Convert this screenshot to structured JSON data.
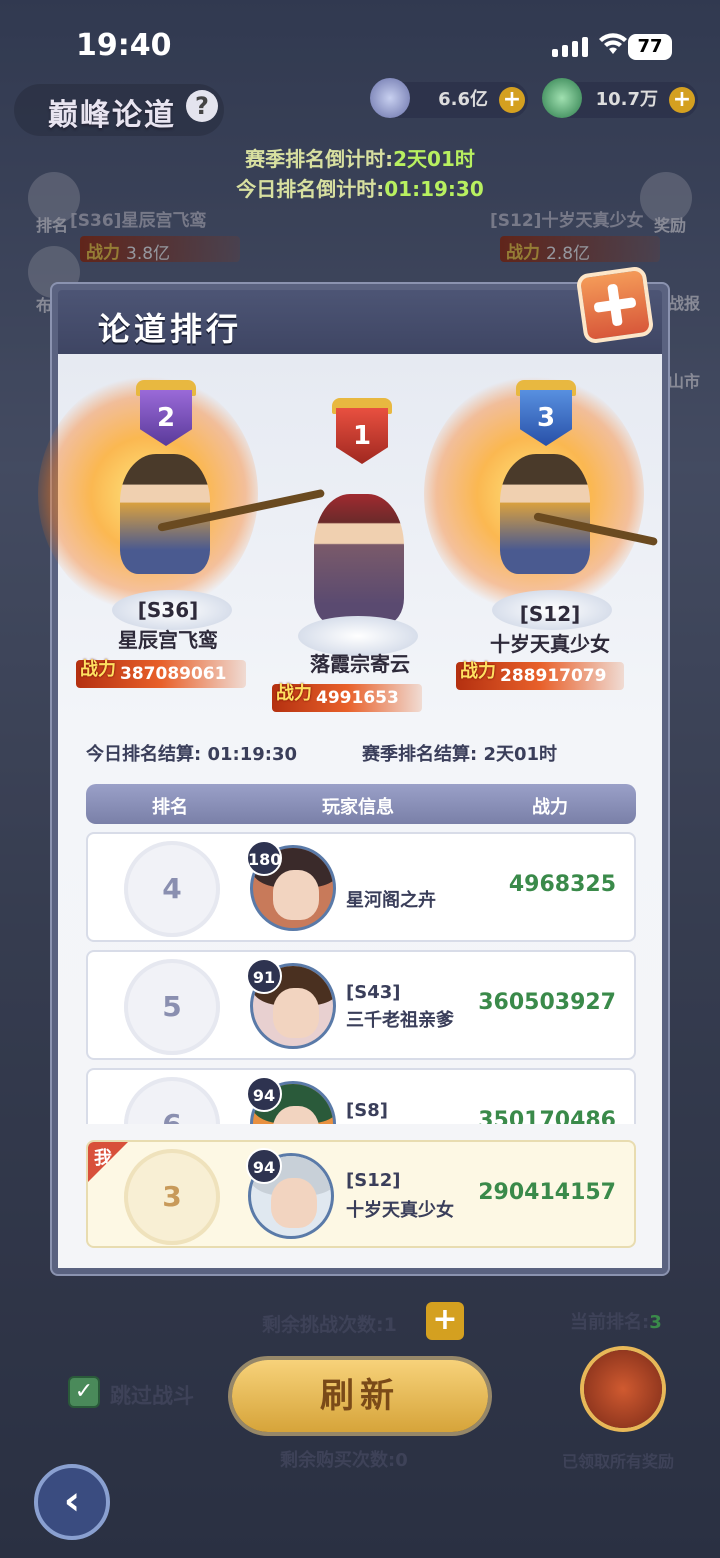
{
  "status": {
    "time": "19:40",
    "battery": "77"
  },
  "header": {
    "title": "巅峰论道",
    "help": "?",
    "currency1": "6.6亿",
    "currency2": "10.7万",
    "season_countdown_label": "赛季排名倒计时:",
    "season_countdown_value": "2天01时",
    "today_countdown_label": "今日排名倒计时:",
    "today_countdown_value": "01:19:30"
  },
  "side": {
    "rank": "排名",
    "layout": "布",
    "reward": "奖励",
    "report": "战报",
    "market": "山市"
  },
  "bg_cards": {
    "left_name": "[S36]星辰宫飞鸾",
    "left_power": "3.8亿",
    "right_name": "[S12]十岁天真少女",
    "right_power": "2.8亿",
    "power_label": "战力"
  },
  "panel": {
    "title": "论道排行",
    "power_label": "战力",
    "podium": [
      {
        "rank": "2",
        "server": "[S36]",
        "name": "星辰宫飞鸾",
        "power": "387089061"
      },
      {
        "rank": "1",
        "server": "",
        "name": "落霞宗寄云",
        "power": "4991653"
      },
      {
        "rank": "3",
        "server": "[S12]",
        "name": "十岁天真少女",
        "power": "288917079"
      }
    ],
    "today_settle": "今日排名结算: 01:19:30",
    "season_settle": "赛季排名结算: 2天01时",
    "columns": {
      "rank": "排名",
      "info": "玩家信息",
      "power": "战力"
    },
    "rows": [
      {
        "rank": "4",
        "level": "180",
        "server": "",
        "name": "星河阁之卉",
        "power": "4968325"
      },
      {
        "rank": "5",
        "level": "91",
        "server": "[S43]",
        "name": "三千老祖亲爹",
        "power": "360503927"
      },
      {
        "rank": "6",
        "level": "94",
        "server": "[S8]",
        "name": "",
        "power": "350170486"
      }
    ],
    "me": {
      "tag": "我",
      "rank": "3",
      "level": "94",
      "server": "[S12]",
      "name": "十岁天真少女",
      "power": "290414157"
    }
  },
  "bottom": {
    "remaining_challenges_label": "剩余挑战次数:",
    "remaining_challenges_value": "1",
    "current_rank_label": "当前排名:",
    "current_rank_value": "3",
    "skip_battle": "跳过战斗",
    "refresh": "刷新",
    "remaining_purchases_label": "剩余购买次数:",
    "remaining_purchases_value": "0",
    "all_rewards_claimed": "已领取所有奖励"
  }
}
